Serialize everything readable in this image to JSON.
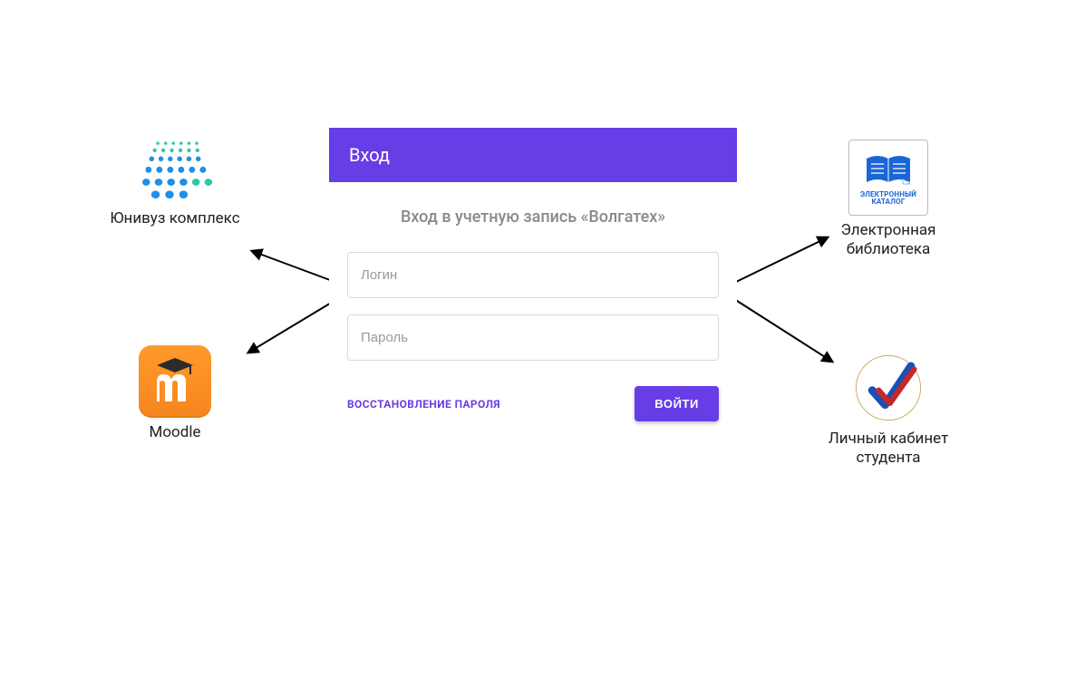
{
  "login": {
    "header": "Вход",
    "subtitle": "Вход в учетную запись «Волгатех»",
    "login_placeholder": "Логин",
    "password_placeholder": "Пароль",
    "reset_label": "ВОССТАНОВЛЕНИЕ ПАРОЛЯ",
    "submit_label": "ВОЙТИ"
  },
  "services": {
    "univuz": {
      "label": "Юнивуз комплекс"
    },
    "moodle": {
      "label": "Moodle"
    },
    "elib": {
      "label": "Электронная библиотека",
      "tile_line1": "ЭЛЕКТРОННЫЙ",
      "tile_line2": "КАТАЛОГ"
    },
    "lk": {
      "label": "Личный кабинет студента"
    }
  }
}
